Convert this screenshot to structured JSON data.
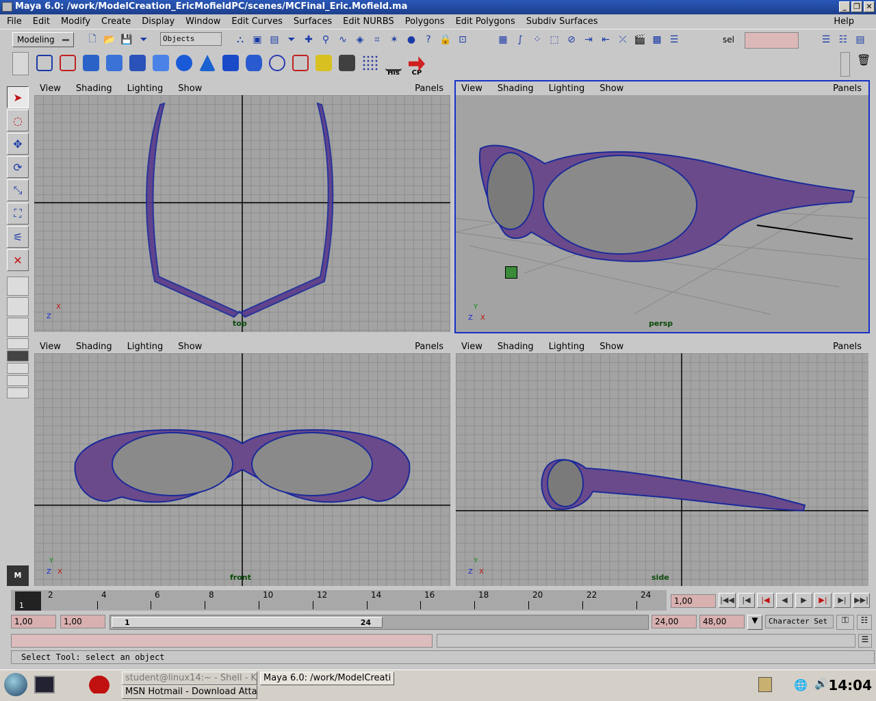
{
  "window": {
    "title": "Maya 6.0: /work/ModelCreation_EricMofieldPC/scenes/MCFinal_Eric.Mofield.ma",
    "buttons": [
      "_",
      "❐",
      "✕"
    ]
  },
  "menubar": {
    "items": [
      "File",
      "Edit",
      "Modify",
      "Create",
      "Display",
      "Window",
      "Edit Curves",
      "Surfaces",
      "Edit NURBS",
      "Polygons",
      "Edit Polygons",
      "Subdiv Surfaces"
    ],
    "help": "Help"
  },
  "statusline": {
    "mode": "Modeling",
    "objects_field": "Objects",
    "sel_label": "sel",
    "sel_value": ""
  },
  "shelf": {
    "labels": [
      "His",
      "CP"
    ]
  },
  "viewports": [
    {
      "menu": [
        "View",
        "Shading",
        "Lighting",
        "Show"
      ],
      "panels": "Panels",
      "name": "top",
      "axes": {
        "a": "X",
        "b": "Z"
      }
    },
    {
      "menu": [
        "View",
        "Shading",
        "Lighting",
        "Show"
      ],
      "panels": "Panels",
      "name": "persp",
      "axes": {
        "a": "X",
        "b": "Z",
        "c": "Y"
      }
    },
    {
      "menu": [
        "View",
        "Shading",
        "Lighting",
        "Show"
      ],
      "panels": "Panels",
      "name": "front",
      "axes": {
        "a": "X",
        "b": "Z",
        "c": "Y"
      }
    },
    {
      "menu": [
        "View",
        "Shading",
        "Lighting",
        "Show"
      ],
      "panels": "Panels",
      "name": "side",
      "axes": {
        "a": "X",
        "b": "Z",
        "c": "Y"
      }
    }
  ],
  "timeline": {
    "current_frame": "1",
    "ticks": [
      "2",
      "4",
      "6",
      "8",
      "10",
      "12",
      "14",
      "16",
      "18",
      "20",
      "22",
      "24"
    ],
    "current_time_field": "1,00",
    "start_time": "1,00",
    "playback_start": "1,00",
    "range_start": "1",
    "range_end": "24",
    "playback_end": "24,00",
    "end_time": "48,00",
    "character_set": "Character Set"
  },
  "helpline": {
    "text": "Select Tool: select an object"
  },
  "taskbar": {
    "tasks": [
      "student@linux14:~ - Shell - K",
      "Maya 6.0: /work/ModelCreati",
      "MSN Hotmail - Download Atta"
    ],
    "clock": "14:04"
  },
  "colors": {
    "active_viewport_border": "#1530c8",
    "wireframe": "#1a2a9a",
    "mesh_fill": "#7a5a8a",
    "timeline_field": "#d8b0b0"
  }
}
